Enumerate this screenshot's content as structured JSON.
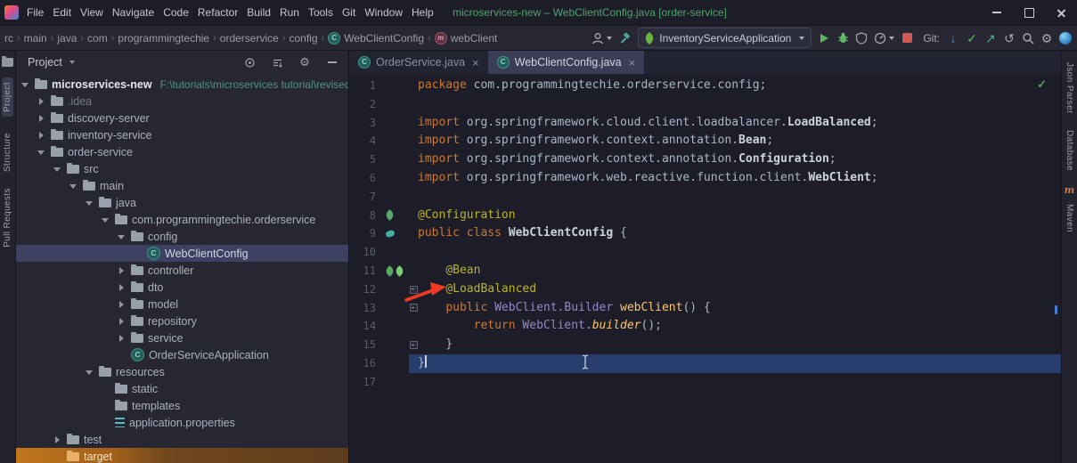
{
  "window": {
    "title": "microservices-new – WebClientConfig.java [order-service]",
    "menu_items": [
      "File",
      "Edit",
      "View",
      "Navigate",
      "Code",
      "Refactor",
      "Build",
      "Run",
      "Tools",
      "Git",
      "Window",
      "Help"
    ]
  },
  "toolbar": {
    "breadcrumbs": [
      {
        "label": "rc"
      },
      {
        "label": "main"
      },
      {
        "label": "java"
      },
      {
        "label": "com"
      },
      {
        "label": "programmingtechie"
      },
      {
        "label": "orderservice"
      },
      {
        "label": "config"
      },
      {
        "label": "WebClientConfig",
        "icon": "class"
      },
      {
        "label": "webClient",
        "icon": "method"
      }
    ],
    "run_config": "InventoryServiceApplication",
    "git_label": "Git:"
  },
  "left_strip": {
    "labels": [
      "Project",
      "Structure",
      "Pull Requests"
    ]
  },
  "right_strip": {
    "labels": [
      "Json Parser",
      "Database",
      "Maven"
    ]
  },
  "project": {
    "header_title": "Project",
    "tree": [
      {
        "level": 0,
        "chev": "open",
        "icon": "folder",
        "label": "microservices-new",
        "sublabel": "F:\\tutorials\\microservices tutorial\\revised\\m",
        "bold": true
      },
      {
        "level": 1,
        "chev": "closed",
        "icon": "folder",
        "label": ".idea",
        "dim": true
      },
      {
        "level": 1,
        "chev": "closed",
        "icon": "folder",
        "label": "discovery-server"
      },
      {
        "level": 1,
        "chev": "closed",
        "icon": "folder",
        "label": "inventory-service"
      },
      {
        "level": 1,
        "chev": "open",
        "icon": "folder",
        "label": "order-service"
      },
      {
        "level": 2,
        "chev": "open",
        "icon": "folder",
        "label": "src"
      },
      {
        "level": 3,
        "chev": "open",
        "icon": "folder",
        "label": "main"
      },
      {
        "level": 4,
        "chev": "open",
        "icon": "folder",
        "label": "java"
      },
      {
        "level": 5,
        "chev": "open",
        "icon": "package",
        "label": "com.programmingtechie.orderservice"
      },
      {
        "level": 6,
        "chev": "open",
        "icon": "package",
        "label": "config"
      },
      {
        "level": 7,
        "chev": "none",
        "icon": "class",
        "label": "WebClientConfig",
        "selected": true
      },
      {
        "level": 6,
        "chev": "closed",
        "icon": "package",
        "label": "controller"
      },
      {
        "level": 6,
        "chev": "closed",
        "icon": "package",
        "label": "dto"
      },
      {
        "level": 6,
        "chev": "closed",
        "icon": "package",
        "label": "model"
      },
      {
        "level": 6,
        "chev": "closed",
        "icon": "package",
        "label": "repository"
      },
      {
        "level": 6,
        "chev": "closed",
        "icon": "package",
        "label": "service"
      },
      {
        "level": 6,
        "chev": "none",
        "icon": "class",
        "label": "OrderServiceApplication"
      },
      {
        "level": 4,
        "chev": "open",
        "icon": "folder",
        "label": "resources"
      },
      {
        "level": 5,
        "chev": "none",
        "icon": "folder",
        "label": "static"
      },
      {
        "level": 5,
        "chev": "none",
        "icon": "folder",
        "label": "templates"
      },
      {
        "level": 5,
        "chev": "none",
        "icon": "props",
        "label": "application.properties"
      },
      {
        "level": 2,
        "chev": "closed",
        "icon": "folder",
        "label": "test"
      },
      {
        "level": 2,
        "chev": "none",
        "icon": "folder",
        "label": "target",
        "highlight": true
      }
    ]
  },
  "editor": {
    "tabs": [
      {
        "label": "OrderService.java",
        "active": false
      },
      {
        "label": "WebClientConfig.java",
        "active": true
      }
    ],
    "lines": [
      {
        "segs": [
          [
            "k",
            "package"
          ],
          [
            "d",
            " com.programmingtechie.orderservice.config;"
          ]
        ]
      },
      {
        "segs": []
      },
      {
        "segs": [
          [
            "k",
            "import"
          ],
          [
            "d",
            " org.springframework.cloud.client.loadbalancer."
          ],
          [
            "c",
            "LoadBalanced"
          ],
          [
            "d",
            ";"
          ]
        ]
      },
      {
        "segs": [
          [
            "k",
            "import"
          ],
          [
            "d",
            " org.springframework.context.annotation."
          ],
          [
            "c",
            "Bean"
          ],
          [
            "d",
            ";"
          ]
        ]
      },
      {
        "segs": [
          [
            "k",
            "import"
          ],
          [
            "d",
            " org.springframework.context.annotation."
          ],
          [
            "c",
            "Configuration"
          ],
          [
            "d",
            ";"
          ]
        ]
      },
      {
        "segs": [
          [
            "k",
            "import"
          ],
          [
            "d",
            " org.springframework.web.reactive.function.client."
          ],
          [
            "c",
            "WebClient"
          ],
          [
            "d",
            ";"
          ]
        ]
      },
      {
        "segs": []
      },
      {
        "segs": [
          [
            "a",
            "@Configuration"
          ]
        ],
        "gutter": [
          "leaf"
        ]
      },
      {
        "segs": [
          [
            "k",
            "public class"
          ],
          [
            "c",
            " WebClientConfig "
          ],
          [
            "d",
            "{"
          ]
        ],
        "gutter": [
          "bean"
        ]
      },
      {
        "segs": []
      },
      {
        "segs": [
          [
            "d",
            "    "
          ],
          [
            "a",
            "@Bean"
          ]
        ],
        "gutter": [
          "leaf",
          "bean2"
        ]
      },
      {
        "segs": [
          [
            "d",
            "    "
          ],
          [
            "a",
            "@LoadBalanced"
          ]
        ],
        "fold": true
      },
      {
        "segs": [
          [
            "d",
            "    "
          ],
          [
            "k",
            "public"
          ],
          [
            "d",
            " "
          ],
          [
            "t",
            "WebClient.Builder"
          ],
          [
            "d",
            " "
          ],
          [
            "m",
            "webClient"
          ],
          [
            "d",
            "() {"
          ]
        ],
        "fold": true
      },
      {
        "segs": [
          [
            "d",
            "        "
          ],
          [
            "k",
            "return"
          ],
          [
            "d",
            " "
          ],
          [
            "t",
            "WebClient"
          ],
          [
            "d",
            "."
          ],
          [
            "s",
            "builder"
          ],
          [
            "d",
            "();"
          ]
        ]
      },
      {
        "segs": [
          [
            "d",
            "    }"
          ]
        ],
        "fold": true
      },
      {
        "segs": [
          [
            "d",
            "}"
          ]
        ],
        "caret": true
      },
      {
        "segs": []
      }
    ]
  },
  "colors": {
    "title_teal": "#4fa373",
    "run_green": "#5cb85c",
    "stop_red": "#cf5b56",
    "arrow_red": "#ee3a23",
    "caret_line_blue": "#283e6e",
    "selection_purple": "#3d4162",
    "target_highlight_orange": "#a2601b"
  }
}
